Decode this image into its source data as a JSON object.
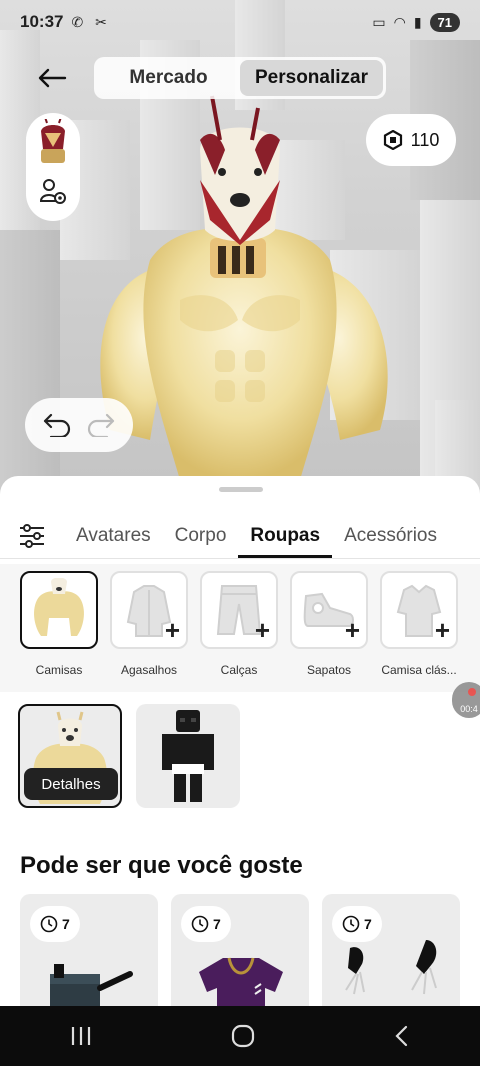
{
  "status_bar": {
    "time": "10:37",
    "battery": "71"
  },
  "header": {
    "tabs": [
      {
        "label": "Mercado",
        "active": false
      },
      {
        "label": "Personalizar",
        "active": true
      }
    ],
    "robux_balance": "110"
  },
  "category_tabs": [
    {
      "label": "Avatares",
      "active": false
    },
    {
      "label": "Corpo",
      "active": false
    },
    {
      "label": "Roupas",
      "active": true
    },
    {
      "label": "Acessórios",
      "active": false
    }
  ],
  "subcategories": [
    {
      "label": "Camisas",
      "selected": true,
      "icon": "shirt-thumbnail"
    },
    {
      "label": "Agasalhos",
      "selected": false,
      "icon": "jacket-icon"
    },
    {
      "label": "Calças",
      "selected": false,
      "icon": "pants-icon"
    },
    {
      "label": "Sapatos",
      "selected": false,
      "icon": "sneaker-icon"
    },
    {
      "label": "Camisa clás...",
      "selected": false,
      "icon": "classic-shirt-icon"
    }
  ],
  "owned_items": [
    {
      "name": "doge-muscle-shirt",
      "selected": true,
      "button": "Detalhes"
    },
    {
      "name": "skeleton-outfit",
      "selected": false
    }
  ],
  "recommendations": {
    "title": "Pode ser que você goste",
    "items": [
      {
        "timer": "7",
        "icon": "stove-item"
      },
      {
        "timer": "7",
        "icon": "purple-shirt-item"
      },
      {
        "timer": "7",
        "icon": "claws-item"
      }
    ]
  },
  "recording_badge": {
    "time": "00:4"
  },
  "colors": {
    "accent": "#111111",
    "sheet_bg": "#ffffff",
    "panel_bg": "#f6f6f6",
    "scene_bg": "#d2d2d2"
  }
}
